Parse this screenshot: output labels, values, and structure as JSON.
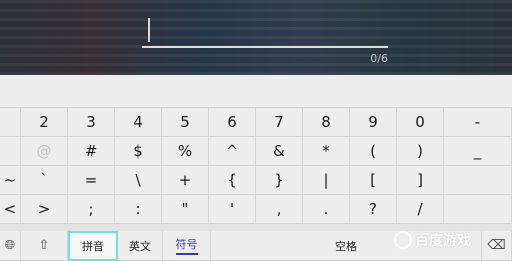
{
  "input": {
    "counter": "0/6"
  },
  "rows": [
    [
      "",
      "2",
      "3",
      "4",
      "5",
      "6",
      "7",
      "8",
      "9",
      "0",
      "-"
    ],
    [
      "",
      "@",
      "#",
      "$",
      "%",
      "^",
      "&",
      "*",
      "(",
      ")",
      "_"
    ],
    [
      "~",
      "`",
      "=",
      "\\",
      "+",
      "{",
      "}",
      "|",
      "[",
      "]",
      ""
    ],
    [
      "<",
      ">",
      ";",
      ":",
      "\"",
      "'",
      ",",
      ".",
      "?",
      "/",
      ""
    ]
  ],
  "bottom": {
    "globe_icon": "globe-icon",
    "shift_icon": "shift-arrow-icon",
    "pinyin": "拼音",
    "english": "英文",
    "symbols": "符号",
    "space": "空格",
    "delete_icon": "backspace-icon"
  },
  "watermark": {
    "text": "百度游戏"
  }
}
